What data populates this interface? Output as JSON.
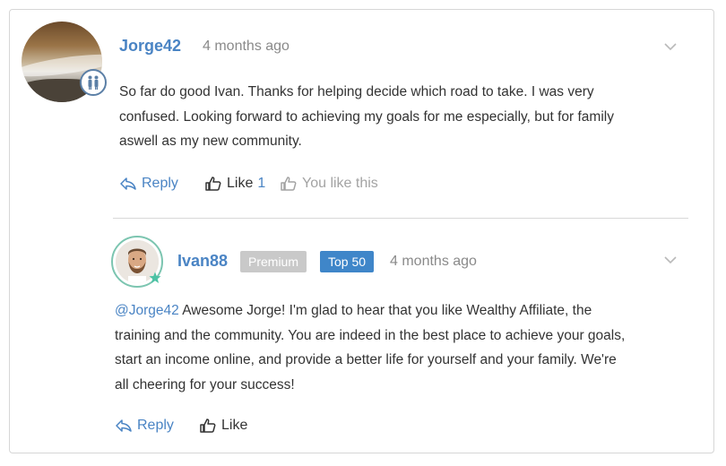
{
  "comment": {
    "author": "Jorge42",
    "time": "4 months ago",
    "lines": [
      "So far do good Ivan. Thanks for helping decide which road to take. I was very",
      "confused. Looking forward to achieving my goals for me especially, but for family",
      "aswell as my new community."
    ],
    "actions": {
      "reply_label": "Reply",
      "like_label": "Like",
      "like_count": "1",
      "you_like_label": "You like this"
    }
  },
  "reply": {
    "author": "Ivan88",
    "premium_badge": "Premium",
    "rank_badge": "Top 50",
    "time": "4 months ago",
    "mention": "@Jorge42",
    "lines": [
      " Awesome Jorge! I'm glad to hear that you like Wealthy Affiliate, the",
      "training and the community. You are indeed in the best place to achieve your goals,",
      "start an income online, and provide a better life for yourself and your family. We're",
      "all cheering for your success!"
    ],
    "actions": {
      "reply_label": "Reply",
      "like_label": "Like"
    }
  },
  "colors": {
    "link_blue": "#4a84c4",
    "premium_gray": "#c9c9c9",
    "top_blue": "#3f86c9",
    "muted": "#8a8a8a"
  },
  "icons": [
    "chevron-down-icon",
    "reply-arrow-icon",
    "thumbs-up-icon",
    "family-badge-icon",
    "online-star-icon"
  ]
}
